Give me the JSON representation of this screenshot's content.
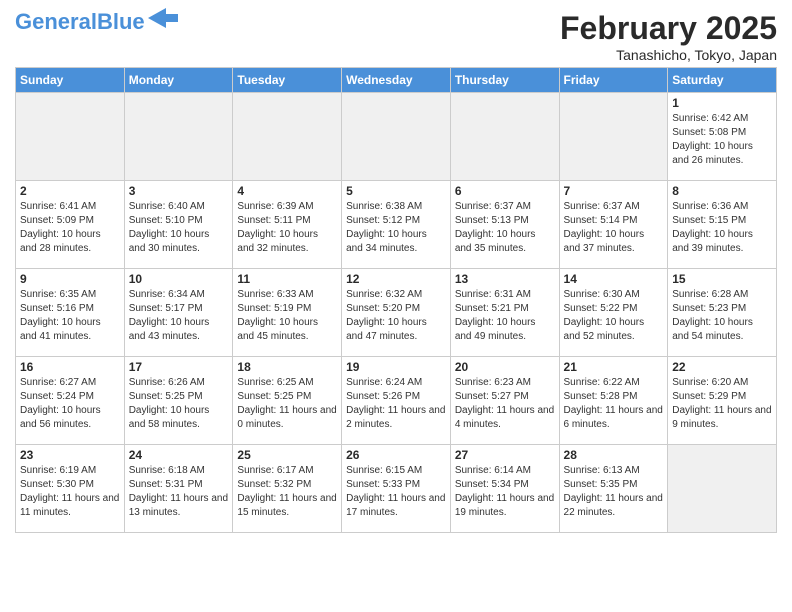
{
  "header": {
    "logo_general": "General",
    "logo_blue": "Blue",
    "title": "February 2025",
    "subtitle": "Tanashicho, Tokyo, Japan"
  },
  "weekdays": [
    "Sunday",
    "Monday",
    "Tuesday",
    "Wednesday",
    "Thursday",
    "Friday",
    "Saturday"
  ],
  "weeks": [
    [
      {
        "day": "",
        "info": "",
        "empty": true
      },
      {
        "day": "",
        "info": "",
        "empty": true
      },
      {
        "day": "",
        "info": "",
        "empty": true
      },
      {
        "day": "",
        "info": "",
        "empty": true
      },
      {
        "day": "",
        "info": "",
        "empty": true
      },
      {
        "day": "",
        "info": "",
        "empty": true
      },
      {
        "day": "1",
        "info": "Sunrise: 6:42 AM\nSunset: 5:08 PM\nDaylight: 10 hours\nand 26 minutes."
      }
    ],
    [
      {
        "day": "2",
        "info": "Sunrise: 6:41 AM\nSunset: 5:09 PM\nDaylight: 10 hours\nand 28 minutes."
      },
      {
        "day": "3",
        "info": "Sunrise: 6:40 AM\nSunset: 5:10 PM\nDaylight: 10 hours\nand 30 minutes."
      },
      {
        "day": "4",
        "info": "Sunrise: 6:39 AM\nSunset: 5:11 PM\nDaylight: 10 hours\nand 32 minutes."
      },
      {
        "day": "5",
        "info": "Sunrise: 6:38 AM\nSunset: 5:12 PM\nDaylight: 10 hours\nand 34 minutes."
      },
      {
        "day": "6",
        "info": "Sunrise: 6:37 AM\nSunset: 5:13 PM\nDaylight: 10 hours\nand 35 minutes."
      },
      {
        "day": "7",
        "info": "Sunrise: 6:37 AM\nSunset: 5:14 PM\nDaylight: 10 hours\nand 37 minutes."
      },
      {
        "day": "8",
        "info": "Sunrise: 6:36 AM\nSunset: 5:15 PM\nDaylight: 10 hours\nand 39 minutes."
      }
    ],
    [
      {
        "day": "9",
        "info": "Sunrise: 6:35 AM\nSunset: 5:16 PM\nDaylight: 10 hours\nand 41 minutes."
      },
      {
        "day": "10",
        "info": "Sunrise: 6:34 AM\nSunset: 5:17 PM\nDaylight: 10 hours\nand 43 minutes."
      },
      {
        "day": "11",
        "info": "Sunrise: 6:33 AM\nSunset: 5:19 PM\nDaylight: 10 hours\nand 45 minutes."
      },
      {
        "day": "12",
        "info": "Sunrise: 6:32 AM\nSunset: 5:20 PM\nDaylight: 10 hours\nand 47 minutes."
      },
      {
        "day": "13",
        "info": "Sunrise: 6:31 AM\nSunset: 5:21 PM\nDaylight: 10 hours\nand 49 minutes."
      },
      {
        "day": "14",
        "info": "Sunrise: 6:30 AM\nSunset: 5:22 PM\nDaylight: 10 hours\nand 52 minutes."
      },
      {
        "day": "15",
        "info": "Sunrise: 6:28 AM\nSunset: 5:23 PM\nDaylight: 10 hours\nand 54 minutes."
      }
    ],
    [
      {
        "day": "16",
        "info": "Sunrise: 6:27 AM\nSunset: 5:24 PM\nDaylight: 10 hours\nand 56 minutes."
      },
      {
        "day": "17",
        "info": "Sunrise: 6:26 AM\nSunset: 5:25 PM\nDaylight: 10 hours\nand 58 minutes."
      },
      {
        "day": "18",
        "info": "Sunrise: 6:25 AM\nSunset: 5:25 PM\nDaylight: 11 hours\nand 0 minutes."
      },
      {
        "day": "19",
        "info": "Sunrise: 6:24 AM\nSunset: 5:26 PM\nDaylight: 11 hours\nand 2 minutes."
      },
      {
        "day": "20",
        "info": "Sunrise: 6:23 AM\nSunset: 5:27 PM\nDaylight: 11 hours\nand 4 minutes."
      },
      {
        "day": "21",
        "info": "Sunrise: 6:22 AM\nSunset: 5:28 PM\nDaylight: 11 hours\nand 6 minutes."
      },
      {
        "day": "22",
        "info": "Sunrise: 6:20 AM\nSunset: 5:29 PM\nDaylight: 11 hours\nand 9 minutes."
      }
    ],
    [
      {
        "day": "23",
        "info": "Sunrise: 6:19 AM\nSunset: 5:30 PM\nDaylight: 11 hours\nand 11 minutes."
      },
      {
        "day": "24",
        "info": "Sunrise: 6:18 AM\nSunset: 5:31 PM\nDaylight: 11 hours\nand 13 minutes."
      },
      {
        "day": "25",
        "info": "Sunrise: 6:17 AM\nSunset: 5:32 PM\nDaylight: 11 hours\nand 15 minutes."
      },
      {
        "day": "26",
        "info": "Sunrise: 6:15 AM\nSunset: 5:33 PM\nDaylight: 11 hours\nand 17 minutes."
      },
      {
        "day": "27",
        "info": "Sunrise: 6:14 AM\nSunset: 5:34 PM\nDaylight: 11 hours\nand 19 minutes."
      },
      {
        "day": "28",
        "info": "Sunrise: 6:13 AM\nSunset: 5:35 PM\nDaylight: 11 hours\nand 22 minutes."
      },
      {
        "day": "",
        "info": "",
        "empty": true
      }
    ]
  ]
}
